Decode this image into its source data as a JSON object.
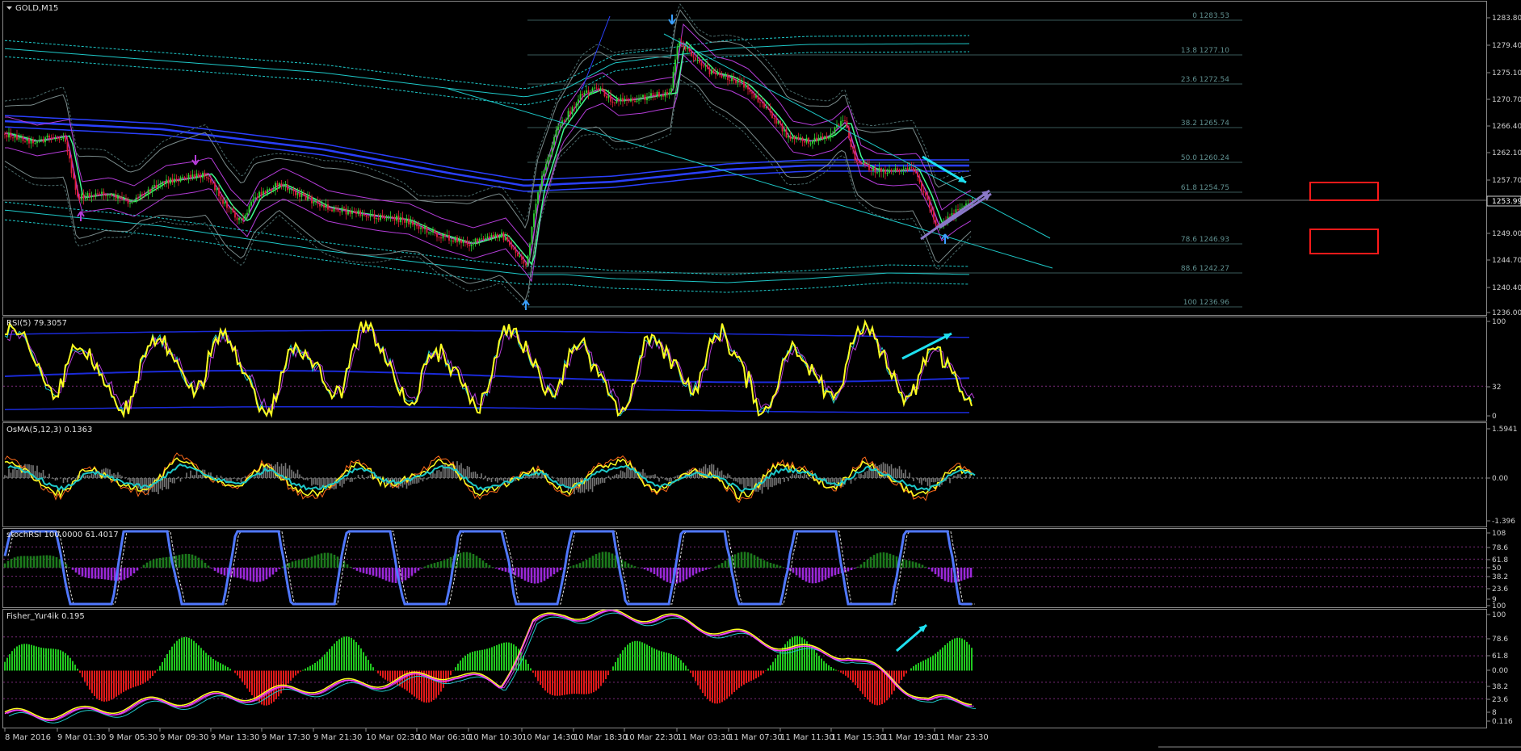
{
  "window": {
    "symbol_title": "GOLD,M15",
    "menu_icon": "triangle-down-icon"
  },
  "colors": {
    "background": "#000000",
    "frame": "#8a8a8a",
    "bull_candle": "#2fd633",
    "bear_candle": "#e0203a",
    "fib_line": "#3a5a5a",
    "fib_text": "#5f8f8f",
    "bollinger_grey": "#7a8a8a",
    "envelope_cyan": "#1ec8c8",
    "envelope_blue": "#2a40ff",
    "ma_purple": "#b43cd8",
    "ma_green": "#40ff90",
    "rsi_yellow": "#ffff20",
    "osma_orange": "#ff6a1a",
    "arrow_cyan": "#1ee0f0",
    "arrow_purple": "#8a78c8",
    "highlight_red": "#ff1a1a",
    "hist_green": "#21c81f",
    "hist_purple": "#9a28d8",
    "hist_red": "#e01a1a",
    "stoch_blue": "#5078ff",
    "fisher_magenta": "#ff40ff"
  },
  "price_pane": {
    "y_axis_labels": [
      "1283.80",
      "1279.40",
      "1275.10",
      "1270.70",
      "1266.40",
      "1262.10",
      "1257.70",
      "1253.99",
      "1249.00",
      "1244.70",
      "1240.40",
      "1236.00"
    ],
    "current_price": "1253.99",
    "fib_levels": [
      "0 1283.53",
      "13.8 1277.10",
      "23.6 1272.54",
      "38.2 1265.74",
      "50.0 1260.24",
      "61.8 1254.75",
      "78.6 1246.93",
      "88.6 1242.27",
      "100 1236.96"
    ],
    "highlighted_fib_levels": [
      "61.8 1254.75",
      "78.6 1246.93"
    ],
    "fractal_arrows": [
      "up",
      "down",
      "down",
      "up",
      "up"
    ]
  },
  "rsi_pane": {
    "label": "RSI(5) 79.3057",
    "y_axis_labels": [
      "100",
      "32",
      "0"
    ]
  },
  "osma_pane": {
    "label": "OsMA(5,12,3) 0.1363",
    "y_axis_labels": [
      "1.5941",
      "0.00",
      "-1.396"
    ]
  },
  "stoch_pane": {
    "label": "stochRSI 100.0000 61.4017",
    "y_axis_labels": [
      "108",
      "78.6",
      "61.8",
      "50",
      "38.2",
      "23.6",
      "9",
      "100"
    ]
  },
  "fisher_pane": {
    "label": "Fisher_Yur4ik 0.195",
    "y_axis_labels": [
      "100",
      "78.6",
      "61.8",
      "0.00",
      "38.2",
      "23.6",
      "8",
      "0.116"
    ]
  },
  "time_axis": {
    "labels": [
      "8 Mar 2016",
      "9 Mar 01:30",
      "9 Mar 05:30",
      "9 Mar 09:30",
      "9 Mar 13:30",
      "9 Mar 17:30",
      "9 Mar 21:30",
      "10 Mar 02:30",
      "10 Mar 06:30",
      "10 Mar 10:30",
      "10 Mar 14:30",
      "10 Mar 18:30",
      "10 Mar 22:30",
      "11 Mar 03:30",
      "11 Mar 07:30",
      "11 Mar 11:30",
      "11 Mar 15:30",
      "11 Mar 19:30",
      "11 Mar 23:30"
    ]
  }
}
